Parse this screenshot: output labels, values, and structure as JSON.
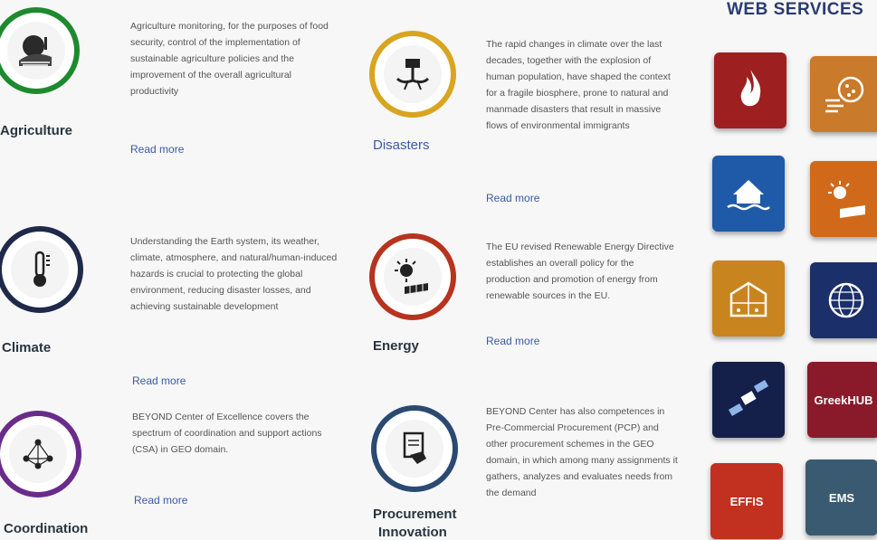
{
  "topics": [
    {
      "title": "Agriculture",
      "icon": "agriculture-icon",
      "ring_color": "#1e8a2e",
      "text": "Agriculture monitoring, for the purposes of food security, control of the implementation of sustainable agriculture policies and the improvement of the overall agricultural productivity",
      "read_more": "Read more"
    },
    {
      "title": "Disasters",
      "icon": "disasters-icon",
      "ring_color": "#d8a520",
      "text": "The rapid changes in climate over the last decades, together with the explosion of human population, have shaped the context for a fragile biosphere, prone to natural and manmade disasters that result in massive flows of environmental immigrants",
      "read_more": "Read more"
    },
    {
      "title": "Climate",
      "icon": "climate-icon",
      "ring_color": "#1f2a4a",
      "text": "Understanding the Earth system, its weather, climate, atmosphere, and natural/human-induced hazards is crucial to protecting the global environment, reducing disaster losses, and achieving sustainable development",
      "read_more": "Read more"
    },
    {
      "title": "Energy",
      "icon": "energy-icon",
      "ring_color": "#b8331f",
      "text": "The EU revised Renewable Energy Directive establishes an overall policy for the production and promotion of energy from renewable sources in the EU.",
      "read_more": "Read more"
    },
    {
      "title": "Coordination",
      "icon": "coordination-icon",
      "ring_color": "#6a2b8a",
      "text": "BEYOND Center of Excellence covers the spectrum of coordination and support actions (CSA) in GEO domain.",
      "read_more": "Read more"
    },
    {
      "title": "Procurement",
      "title2": "Innovation",
      "icon": "procurement-icon",
      "ring_color": "#2a4a72",
      "text": "BEYOND Center has also competences in Pre-Commercial Procurement (PCP) and other procurement schemes in the GEO domain, in which among many assignments it gathers, analyzes and evaluates needs from the demand",
      "read_more": ""
    }
  ],
  "web_services": {
    "title": "WEB SERVICES",
    "tiles": [
      {
        "icon": "fire-icon",
        "label": "",
        "color": "#9e1f1f"
      },
      {
        "icon": "dust-wind-icon",
        "label": "",
        "color": "#c97a2a"
      },
      {
        "icon": "flood-house-icon",
        "label": "",
        "color": "#1f5aa8"
      },
      {
        "icon": "solar-panel-icon",
        "label": "",
        "color": "#d06a1a"
      },
      {
        "icon": "greenhouse-icon",
        "label": "",
        "color": "#c8851f"
      },
      {
        "icon": "globe-thermometer-icon",
        "label": "",
        "color": "#1b2f6a"
      },
      {
        "icon": "satellite-icon",
        "label": "",
        "color": "#14204a"
      },
      {
        "icon": "greekhub-icon",
        "label": "GreekHUB",
        "color": "#8a1a2a"
      },
      {
        "icon": "effis-icon",
        "label": "EFFIS",
        "color": "#c2301f"
      },
      {
        "icon": "ems-icon",
        "label": "EMS",
        "color": "#3a5a72"
      }
    ]
  }
}
